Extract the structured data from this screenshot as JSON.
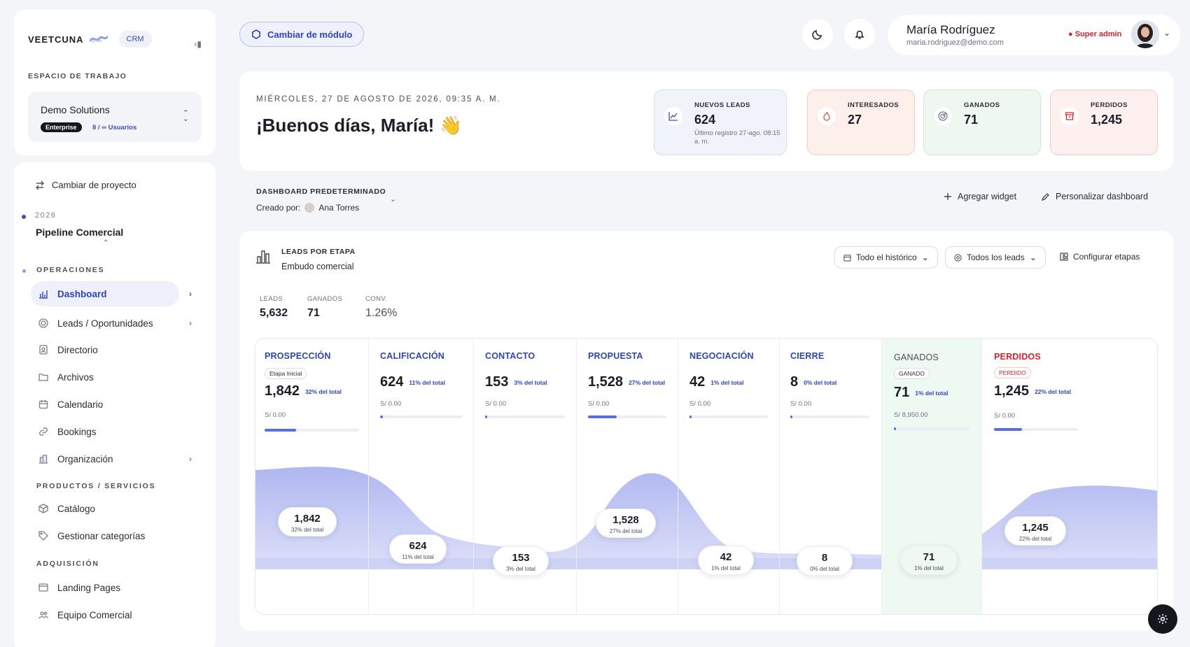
{
  "sidebar": {
    "brand": "VEETCUNA",
    "product": "CRM",
    "workspace_label": "ESPACIO DE TRABAJO",
    "workspace_name": "Demo Solutions",
    "plan": "Enterprise",
    "users": "8 / ∞ Usuarios",
    "switch_project": "Cambiar de proyecto",
    "year": "2026",
    "pipeline": "Pipeline Comercial",
    "sections": {
      "ops": "OPERACIONES",
      "products": "PRODUCTOS / SERVICIOS",
      "acq": "ADQUISICIÓN"
    },
    "items": [
      {
        "label": "Dashboard",
        "icon": "bar-chart-icon",
        "active": true
      },
      {
        "label": "Leads / Oportunidades",
        "icon": "target-icon"
      },
      {
        "label": "Directorio",
        "icon": "contacts-icon"
      },
      {
        "label": "Archivos",
        "icon": "folder-icon"
      },
      {
        "label": "Calendario",
        "icon": "calendar-icon"
      },
      {
        "label": "Bookings",
        "icon": "link-icon"
      },
      {
        "label": "Organización",
        "icon": "building-icon"
      },
      {
        "label": "Catálogo",
        "icon": "box-icon"
      },
      {
        "label": "Gestionar categorías",
        "icon": "tag-icon"
      },
      {
        "label": "Landing Pages",
        "icon": "browser-icon"
      },
      {
        "label": "Equipo Comercial",
        "icon": "team-icon"
      }
    ]
  },
  "topbar": {
    "module_button": "Cambiar de módulo",
    "user_name": "María Rodríguez",
    "user_email": "maria.rodriguez@demo.com",
    "role": "Super admin"
  },
  "hero": {
    "date": "MIÉRCOLES, 27 DE AGOSTO DE 2026, 09:35 A. M.",
    "greeting": "¡Buenos días, María! 👋",
    "stats": [
      {
        "label": "NUEVOS LEADS",
        "value": "624",
        "sub": "Último registro 27-ago. 08:15 a. m."
      },
      {
        "label": "INTERESADOS",
        "value": "27"
      },
      {
        "label": "GANADOS",
        "value": "71"
      },
      {
        "label": "PERDIDOS",
        "value": "1,245"
      }
    ]
  },
  "dashboard": {
    "label": "DASHBOARD PREDETERMINADO",
    "created_by_label": "Creado por:",
    "created_by": "Ana Torres",
    "add_widget": "Agregar widget",
    "customize": "Personalizar dashboard"
  },
  "funnel": {
    "title": "LEADS POR ETAPA",
    "subtitle": "Embudo comercial",
    "filter_time": "Todo el histórico",
    "filter_leads": "Todos los leads",
    "configure": "Configurar etapas",
    "kpis": [
      {
        "label": "LEADS",
        "value": "5,632"
      },
      {
        "label": "GANADOS",
        "value": "71"
      },
      {
        "label": "CONV.",
        "value": "1.26%"
      }
    ],
    "stages": [
      {
        "name": "PROSPECCIÓN",
        "tag": "Etapa Inicial",
        "value": "1,842",
        "pct": "32% del total",
        "money": "S/ 0.00",
        "fill": 0.33
      },
      {
        "name": "CALIFICACIÓN",
        "value": "624",
        "pct": "11% del total",
        "money": "S/ 0.00",
        "fill": 0.03
      },
      {
        "name": "CONTACTO",
        "value": "153",
        "pct": "3% del total",
        "money": "S/ 0.00",
        "fill": 0.03
      },
      {
        "name": "PROPUESTA",
        "value": "1,528",
        "pct": "27% del total",
        "money": "S/ 0.00",
        "fill": 0.37
      },
      {
        "name": "NEGOCIACIÓN",
        "value": "42",
        "pct": "1% del total",
        "money": "S/ 0.00",
        "fill": 0.03
      },
      {
        "name": "CIERRE",
        "value": "8",
        "pct": "0% del total",
        "money": "S/ 0.00",
        "fill": 0.03
      },
      {
        "name": "GANADOS",
        "tag": "GANADO",
        "value": "71",
        "pct": "1% del total",
        "money": "S/ 8,950.00",
        "fill": 0.03
      },
      {
        "name": "PERDIDOS",
        "tag": "PERDIDO",
        "value": "1,245",
        "pct": "22% del total",
        "money": "S/ 0.00",
        "fill": 0.33
      }
    ]
  },
  "colors": {
    "accent": "#2d44c2",
    "danger": "#d9242f",
    "won_bg": "#eef9f1"
  }
}
